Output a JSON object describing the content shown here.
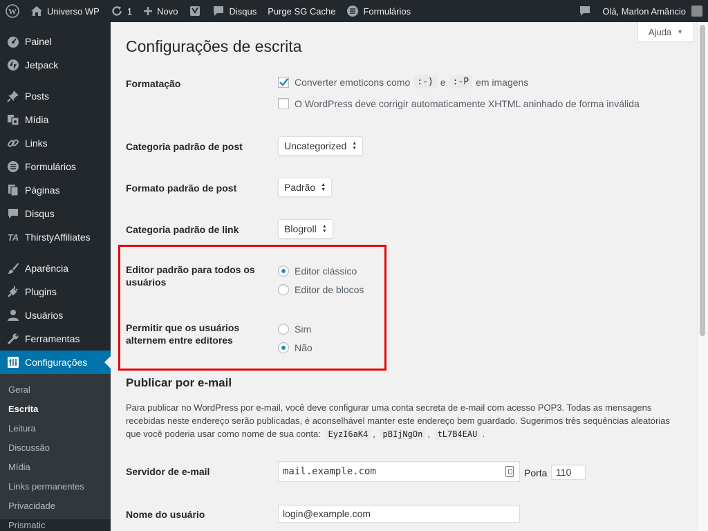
{
  "adminbar": {
    "site_name": "Universo WP",
    "updates_count": "1",
    "new_label": "Novo",
    "disqus_label": "Disqus",
    "purge_label": "Purge SG Cache",
    "forms_label": "Formulários",
    "greeting": "Olá, Marlon Amâncio"
  },
  "sidebar": {
    "items": [
      {
        "label": "Painel",
        "icon": "dashboard-icon"
      },
      {
        "label": "Jetpack",
        "icon": "jetpack-icon"
      },
      {
        "label": "Posts",
        "icon": "pin-icon"
      },
      {
        "label": "Mídia",
        "icon": "media-icon"
      },
      {
        "label": "Links",
        "icon": "link-icon"
      },
      {
        "label": "Formulários",
        "icon": "forms-icon"
      },
      {
        "label": "Páginas",
        "icon": "pages-icon"
      },
      {
        "label": "Disqus",
        "icon": "comment-icon"
      },
      {
        "label": "ThirstyAffiliates",
        "icon": "ta-icon"
      },
      {
        "label": "Aparência",
        "icon": "brush-icon"
      },
      {
        "label": "Plugins",
        "icon": "plugin-icon"
      },
      {
        "label": "Usuários",
        "icon": "users-icon"
      },
      {
        "label": "Ferramentas",
        "icon": "wrench-icon"
      },
      {
        "label": "Configurações",
        "icon": "settings-icon"
      }
    ],
    "submenu": [
      "Geral",
      "Escrita",
      "Leitura",
      "Discussão",
      "Mídia",
      "Links permanentes",
      "Privacidade",
      "Prismatic"
    ]
  },
  "help_tab": "Ajuda",
  "page_title": "Configurações de escrita",
  "formatting": {
    "label": "Formatação",
    "emoticons_pre": "Converter emoticons como",
    "emoticon_a": ":-)",
    "emoticons_and": "e",
    "emoticon_b": ":-P",
    "emoticons_post": "em imagens",
    "emoticons_checked": true,
    "xhtml_label": "O WordPress deve corrigir automaticamente XHTML aninhado de forma inválida",
    "xhtml_checked": false
  },
  "default_category": {
    "label": "Categoria padrão de post",
    "value": "Uncategorized"
  },
  "default_format": {
    "label": "Formato padrão de post",
    "value": "Padrão"
  },
  "link_category": {
    "label": "Categoria padrão de link",
    "value": "Blogroll"
  },
  "editor": {
    "label": "Editor padrão para todos os usuários",
    "options": [
      "Editor clássico",
      "Editor de blocos"
    ],
    "selected": 0
  },
  "switch_editors": {
    "label": "Permitir que os usuários alternem entre editores",
    "options": [
      "Sim",
      "Não"
    ],
    "selected": 1
  },
  "post_via_email": {
    "heading": "Publicar por e-mail",
    "text_1": "Para publicar no WordPress por e-mail, você deve configurar uma conta secreta de e-mail com acesso POP3. Todas as mensagens recebidas neste endereço serão publicadas, é aconselhável manter este endereço bem guardado. Sugerimos três sequências aleatórias que você poderia usar como nome de sua conta:",
    "codes": [
      "EyzI6aK4",
      "pBIjNgOn",
      "tL7B4EAU"
    ],
    "sep": ",",
    "end": "."
  },
  "mail_server": {
    "label": "Servidor de e-mail",
    "value": "mail.example.com",
    "port_label": "Porta",
    "port_value": "110"
  },
  "login_name": {
    "label": "Nome do usuário",
    "value": "login@example.com"
  },
  "colors": {
    "accent": "#0073aa",
    "highlight": "#e2090b",
    "sidebar": "#23282d"
  }
}
